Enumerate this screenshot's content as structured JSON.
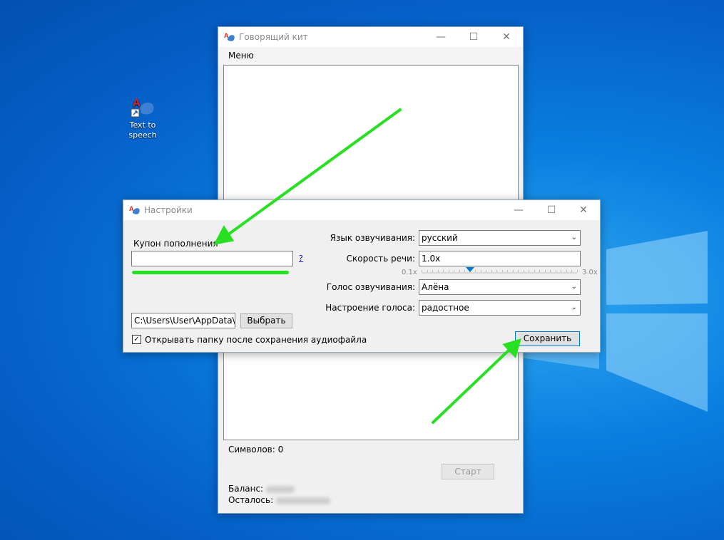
{
  "desktop": {
    "icon_label": "Text to speech",
    "accent_color": "#0a7ee0"
  },
  "main_window": {
    "title": "Говорящий кит",
    "menu": "Меню",
    "chars_label": "Символов: 0",
    "start_button": "Старт",
    "balance_label": "Баланс:",
    "remaining_label": "Осталось:"
  },
  "settings": {
    "title": "Настройки",
    "coupon_label": "Купон пополнения",
    "coupon_value": "",
    "help_link": "?",
    "path_value": "C:\\Users\\User\\AppData\\Lo",
    "choose_button": "Выбрать",
    "open_folder_checkbox": "Открывать папку после сохранения аудиофайла",
    "open_folder_checked": true,
    "language_label": "Язык озвучивания:",
    "language_value": "русский",
    "speed_label": "Скорость речи:",
    "speed_value": "1.0x",
    "speed_min": "0.1x",
    "speed_max": "3.0x",
    "speed_fraction": 0.31,
    "voice_label": "Голос озвучивания:",
    "voice_value": "Алёна",
    "mood_label": "Настроение голоса:",
    "mood_value": "радостное",
    "save_button": "Сохранить"
  },
  "annotations": {
    "arrow_color": "#27e021"
  },
  "icons": [
    "minimize-icon",
    "maximize-icon",
    "close-icon",
    "chevron-down-icon",
    "checkmark-icon",
    "app-logo-icon",
    "windows-logo"
  ]
}
